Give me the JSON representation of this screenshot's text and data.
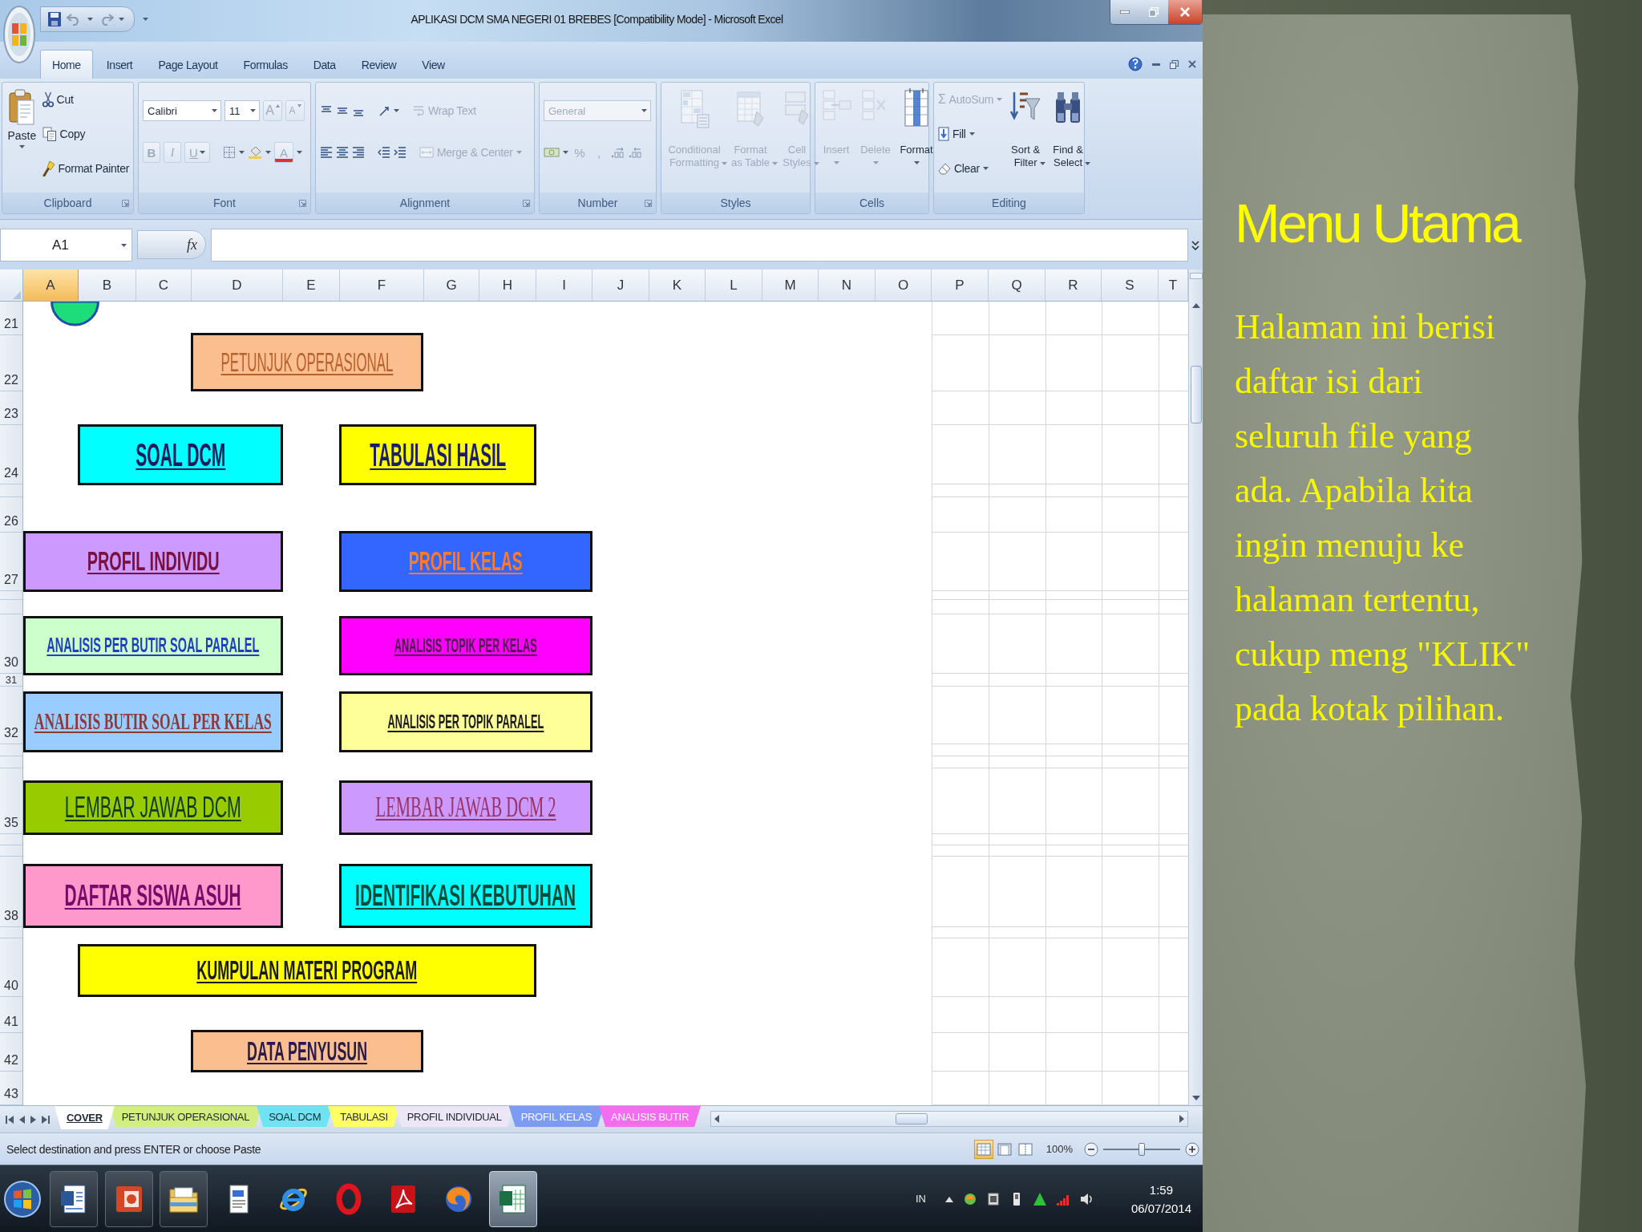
{
  "window": {
    "title": "APLIKASI DCM SMA NEGERI 01 BREBES [Compatibility Mode] - Microsoft Excel"
  },
  "ribbon": {
    "tabs": [
      {
        "label": "Home",
        "selected": true
      },
      {
        "label": "Insert",
        "selected": false
      },
      {
        "label": "Page Layout",
        "selected": false
      },
      {
        "label": "Formulas",
        "selected": false
      },
      {
        "label": "Data",
        "selected": false
      },
      {
        "label": "Review",
        "selected": false
      },
      {
        "label": "View",
        "selected": false
      }
    ],
    "groups": [
      {
        "kind": "clipboard",
        "label": "Clipboard",
        "paste": {
          "label": "Paste",
          "disabled": false
        },
        "commands": [
          {
            "kind": "cut",
            "label": "Cut",
            "disabled": false
          },
          {
            "kind": "copy",
            "label": "Copy",
            "disabled": false
          },
          {
            "kind": "painter",
            "label": "Format Painter",
            "disabled": false
          }
        ]
      },
      {
        "kind": "font",
        "label": "Font",
        "font_name": "Calibri",
        "font_size": "11",
        "size_buttons": [
          {
            "kind": "grow",
            "label": "A",
            "disabled": true
          },
          {
            "kind": "shrink",
            "label": "A",
            "disabled": true
          }
        ],
        "style_buttons": [
          {
            "kind": "bold",
            "label": "B",
            "disabled": true
          },
          {
            "kind": "italic",
            "label": "I",
            "disabled": true
          },
          {
            "kind": "underline",
            "label": "U",
            "disabled": true
          }
        ],
        "font_color": {
          "label": "A",
          "disabled": true
        }
      },
      {
        "kind": "alignment",
        "label": "Alignment",
        "commands": [
          {
            "kind": "wrap",
            "label": "Wrap Text",
            "disabled": true
          },
          {
            "kind": "merge",
            "label": "Merge & Center",
            "disabled": true
          }
        ]
      },
      {
        "kind": "number",
        "label": "Number",
        "format": {
          "value": "General",
          "disabled": true
        },
        "commands": [
          {
            "kind": "percent",
            "label": "%",
            "disabled": true
          },
          {
            "kind": "comma",
            "label": ",",
            "disabled": true
          }
        ]
      },
      {
        "kind": "styles",
        "label": "Styles",
        "commands": [
          {
            "kind": "conditional",
            "label": "Conditional Formatting",
            "disabled": true
          },
          {
            "kind": "table",
            "label": "Format as Table",
            "disabled": true
          },
          {
            "kind": "cellstyles",
            "label": "Cell Styles",
            "disabled": true
          }
        ]
      },
      {
        "kind": "cells",
        "label": "Cells",
        "commands": [
          {
            "kind": "insert",
            "label": "Insert",
            "disabled": true
          },
          {
            "kind": "delete",
            "label": "Delete",
            "disabled": true
          },
          {
            "kind": "format",
            "label": "Format",
            "disabled": false
          }
        ]
      },
      {
        "kind": "editing",
        "label": "Editing",
        "commands": [
          {
            "kind": "autosum",
            "symbol": "Σ",
            "label": "AutoSum",
            "disabled": true
          },
          {
            "kind": "fill",
            "label": "Fill",
            "disabled": false
          },
          {
            "kind": "clear",
            "label": "Clear",
            "disabled": false
          }
        ],
        "large_commands": [
          {
            "kind": "sort",
            "label": "Sort & Filter",
            "disabled": false
          },
          {
            "kind": "find",
            "label": "Find & Select",
            "disabled": false
          }
        ]
      }
    ]
  },
  "formula_bar": {
    "name_box": "A1",
    "function_label": "fx"
  },
  "sheet": {
    "columns": [
      {
        "label": "A",
        "selected": true
      },
      {
        "label": "B",
        "selected": false
      },
      {
        "label": "C",
        "selected": false
      },
      {
        "label": "D",
        "selected": false
      },
      {
        "label": "E",
        "selected": false
      },
      {
        "label": "F",
        "selected": false
      },
      {
        "label": "G",
        "selected": false
      },
      {
        "label": "H",
        "selected": false
      },
      {
        "label": "I",
        "selected": false
      },
      {
        "label": "J",
        "selected": false
      },
      {
        "label": "K",
        "selected": false
      },
      {
        "label": "L",
        "selected": false
      },
      {
        "label": "M",
        "selected": false
      },
      {
        "label": "N",
        "selected": false
      },
      {
        "label": "O",
        "selected": false
      },
      {
        "label": "P",
        "selected": false
      },
      {
        "label": "Q",
        "selected": false
      },
      {
        "label": "R",
        "selected": false
      },
      {
        "label": "S",
        "selected": false
      },
      {
        "label": "T",
        "selected": false
      }
    ],
    "row_numbers": [
      "21",
      "22",
      "23",
      "24",
      "26",
      "27",
      "30",
      "31",
      "32",
      "35",
      "38",
      "40",
      "41",
      "42",
      "43"
    ],
    "shapes": [
      {
        "label": "PETUNJUK OPERASIONAL",
        "color": "#fbbf8f"
      },
      {
        "label": "SOAL DCM",
        "color": "#00ffff"
      },
      {
        "label": "TABULASI HASIL",
        "color": "#ffff00"
      },
      {
        "label": "PROFIL INDIVIDU",
        "color": "#cc99ff"
      },
      {
        "label": "PROFIL KELAS",
        "color": "#3366ff"
      },
      {
        "label": "ANALISIS PER BUTIR SOAL PARALEL",
        "color": "#ccffcc"
      },
      {
        "label": "ANALISIS TOPIK PER KELAS",
        "color": "#ff00ff"
      },
      {
        "label": "ANALISIS BUTIR SOAL PER KELAS",
        "color": "#99ccff"
      },
      {
        "label": "ANALISIS PER TOPIK PARALEL",
        "color": "#ffff99"
      },
      {
        "label": "LEMBAR JAWAB DCM",
        "color": "#99cc00"
      },
      {
        "label": "LEMBAR JAWAB DCM 2",
        "color": "#cc99ff"
      },
      {
        "label": "DAFTAR SISWA ASUH",
        "color": "#ff99cc"
      },
      {
        "label": "IDENTIFIKASI KEBUTUHAN",
        "color": "#00ffff"
      },
      {
        "label": "KUMPULAN MATERI PROGRAM",
        "color": "#ffff00"
      },
      {
        "label": "DATA PENYUSUN",
        "color": "#fbbf8f"
      }
    ]
  },
  "sheet_tabs": [
    {
      "label": "COVER",
      "selected": true,
      "color": "#ffffff"
    },
    {
      "label": "PETUNJUK OPERASIONAL",
      "selected": false,
      "color": "#d2ee7e"
    },
    {
      "label": "SOAL DCM",
      "selected": false,
      "color": "#6fe3f2"
    },
    {
      "label": "TABULASI",
      "selected": false,
      "color": "#ffff66"
    },
    {
      "label": "PROFIL INDIVIDUAL",
      "selected": false,
      "color": "#ece6f7"
    },
    {
      "label": "PROFIL KELAS",
      "selected": false,
      "color": "#7b9cf2"
    },
    {
      "label": "ANALISIS BUTIR",
      "selected": false,
      "color": "#f46cef"
    }
  ],
  "status_bar": {
    "message": "Select destination and press ENTER or choose Paste",
    "views": [
      {
        "kind": "normal",
        "selected": true
      },
      {
        "kind": "layout",
        "selected": false
      },
      {
        "kind": "pagebreak",
        "selected": false
      }
    ],
    "zoom": "100%",
    "zoom_slider": {
      "level": 0.5
    }
  },
  "taskbar": {
    "apps": [
      {
        "kind": "document",
        "running": true,
        "selected": false
      },
      {
        "kind": "presentation",
        "running": true,
        "selected": false
      },
      {
        "kind": "folder",
        "running": true,
        "selected": false
      },
      {
        "kind": "notepad",
        "running": false,
        "selected": false
      },
      {
        "kind": "browser",
        "running": false,
        "selected": false
      },
      {
        "kind": "ring",
        "running": false,
        "selected": false
      },
      {
        "kind": "reader",
        "running": false,
        "selected": false
      },
      {
        "kind": "globe",
        "running": false,
        "selected": false
      },
      {
        "kind": "spreadsheet",
        "running": true,
        "selected": true
      }
    ],
    "language": "IN",
    "tray_icons": [
      {
        "kind": "arrow"
      },
      {
        "kind": "badge"
      },
      {
        "kind": "square"
      },
      {
        "kind": "device"
      },
      {
        "kind": "triangle"
      },
      {
        "kind": "signal"
      },
      {
        "kind": "speaker"
      }
    ],
    "time": "1:59",
    "date": "06/07/2014"
  },
  "slide": {
    "title": "Menu Utama",
    "body": "Halaman ini berisi daftar isi dari seluruh file yang ada. Apabila kita ingin menuju ke halaman tertentu, cukup meng \"KLIK\" pada kotak pilihan."
  }
}
